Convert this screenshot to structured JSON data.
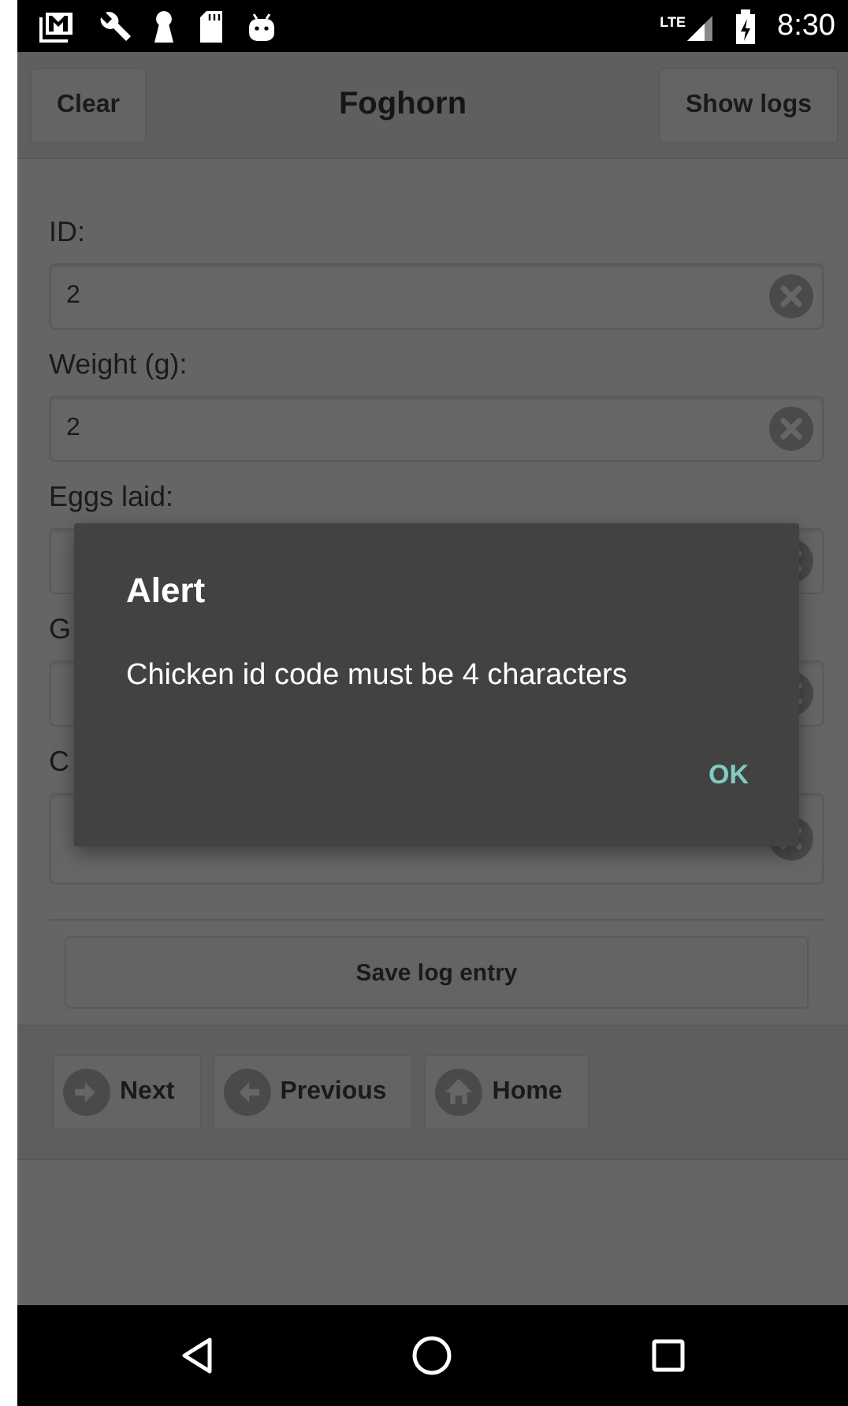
{
  "status_bar": {
    "network": "LTE",
    "time": "8:30"
  },
  "header": {
    "title": "Foghorn",
    "left_button": "Clear",
    "right_button": "Show logs"
  },
  "form": {
    "fields": [
      {
        "kind": "text",
        "label": "ID:",
        "value": "2"
      },
      {
        "kind": "text",
        "label": "Weight (g):",
        "value": "2"
      },
      {
        "kind": "text",
        "label": "Eggs laid:"
      },
      {
        "kind": "text",
        "label": "G"
      },
      {
        "kind": "tall",
        "label": "C"
      }
    ],
    "save_button": "Save log entry"
  },
  "footer": {
    "buttons": [
      {
        "kind": "next",
        "label": "Next"
      },
      {
        "kind": "previous",
        "label": "Previous"
      },
      {
        "kind": "home",
        "label": "Home"
      }
    ]
  },
  "dialog": {
    "title": "Alert",
    "message": "Chicken id code must be 4 characters",
    "ok": "OK"
  }
}
